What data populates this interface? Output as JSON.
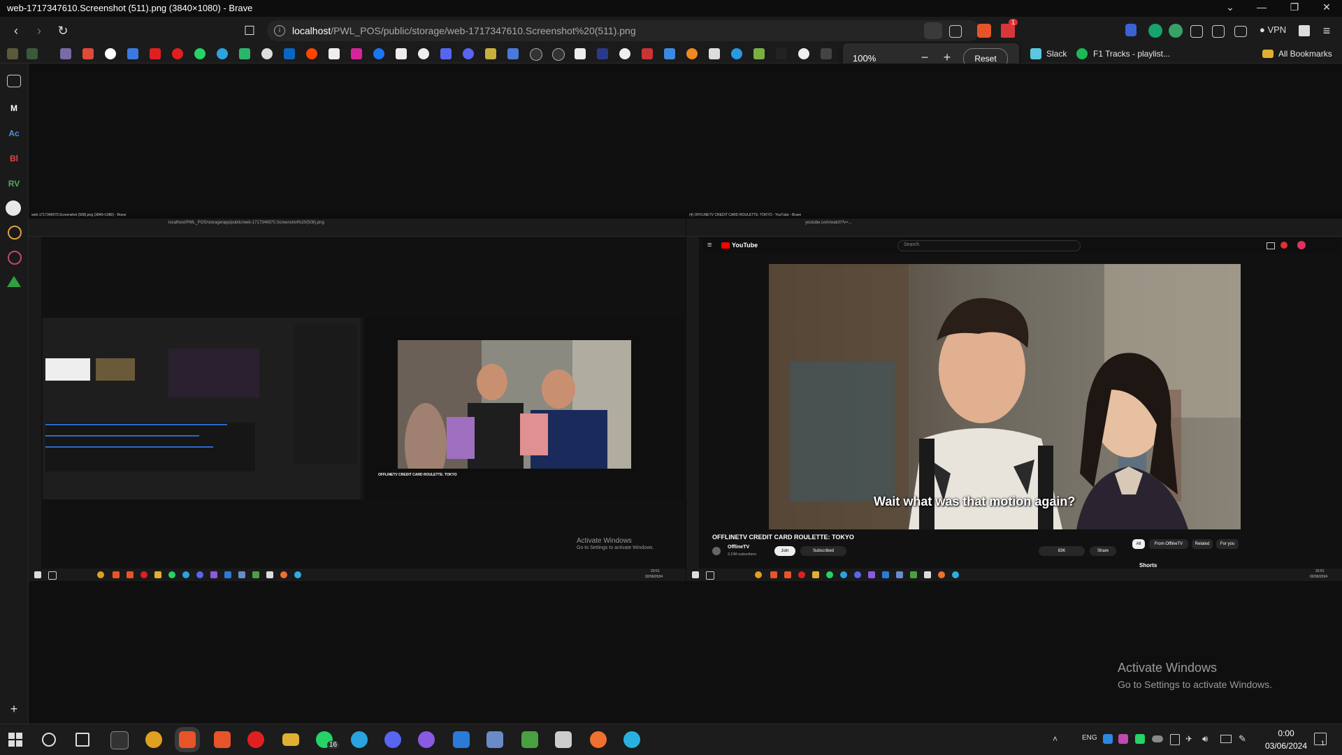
{
  "window": {
    "title": "web-1717347610.Screenshot (511).png (3840×1080) - Brave",
    "controls": [
      "⌄",
      "—",
      "❐",
      "✕"
    ]
  },
  "toolbar": {
    "url_host": "localhost",
    "url_path": "/PWL_POS/public/storage/web-1717347610.Screenshot%20(511).png",
    "badge_count": "1",
    "vpn_label": "VPN"
  },
  "bookmarks": {
    "slack_label": "Slack",
    "f1_label": "F1 Tracks - playlist...",
    "all_bookmarks_label": "All Bookmarks"
  },
  "zoom_popup": {
    "level": "100%",
    "minus": "−",
    "plus": "+",
    "reset_label": "Reset"
  },
  "sidebar": {
    "items": [
      "M",
      "Ac",
      "Bl",
      "RV"
    ],
    "add": "+"
  },
  "screenshot": {
    "left_title": "web-1717346970.Screenshot (508).png (3840×1080) - Brave",
    "left_url": "localhost/PWL_POS/storage/app/public/web-1717346970.Screenshot%20(508).png",
    "right_title": "(4) OFFLINETV CREDIT CARD ROULETTE: TOKYO - YouTube - Brave",
    "right_url": "youtube.com/watch?v=...",
    "youtube_logo": "YouTube",
    "search_placeholder": "Search",
    "subtitle": "Wait what was that motion again?",
    "video_title": "OFFLINETV CREDIT CARD ROULETTE: TOKYO",
    "channel_name": "OfflineTV",
    "subscribers": "3.19M subscribers",
    "join_label": "Join",
    "subscribed_label": "Subscribed",
    "likes": "83K",
    "share_label": "Share",
    "chips": [
      "All",
      "From OfflineTV",
      "Related",
      "For you"
    ],
    "shorts_label": "Shorts",
    "mini_title": "OFFLINETV CREDIT CARD ROULETTE: TOKYO",
    "activate_small_title": "Activate Windows",
    "activate_small_sub": "Go to Settings to activate Windows.",
    "left_clock": "23:51",
    "left_date": "02/06/2024",
    "right_clock": "23:51",
    "right_date": "02/06/2024"
  },
  "activate_windows": {
    "title": "Activate Windows",
    "subtitle": "Go to Settings to activate Windows."
  },
  "taskbar": {
    "whatsapp_badge": "16",
    "tray_lang": "ENG",
    "time": "0:00",
    "date": "03/06/2024",
    "notif_count": "1"
  }
}
